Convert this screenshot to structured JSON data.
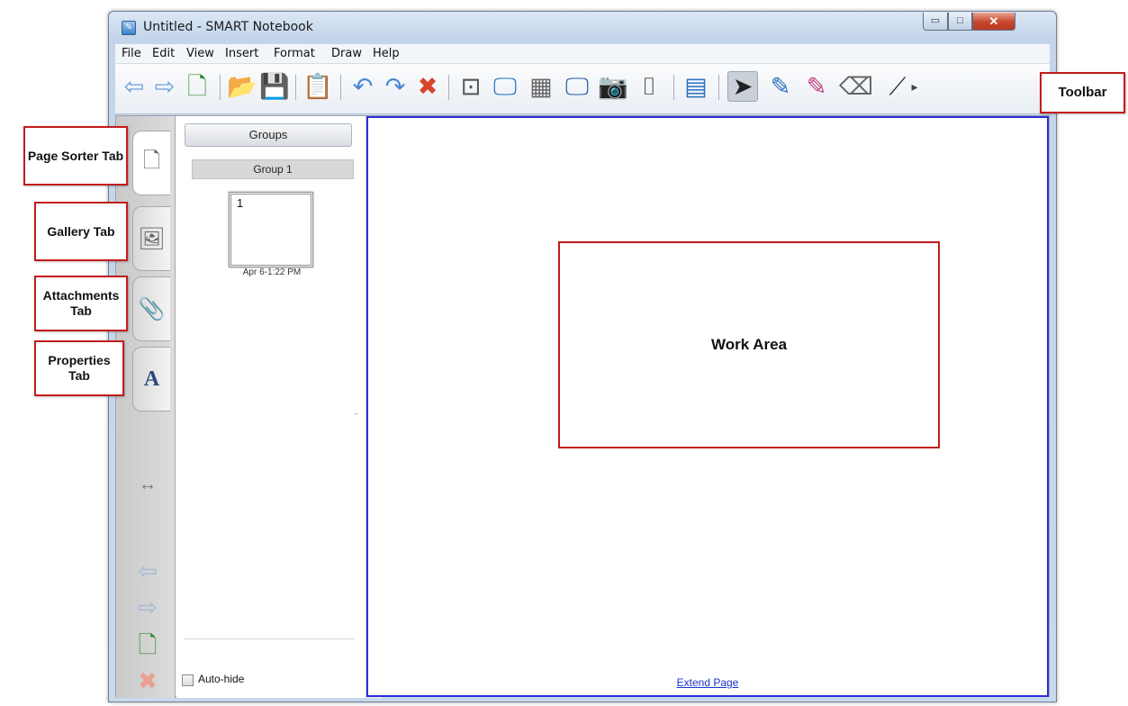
{
  "window": {
    "title": "Untitled - SMART Notebook",
    "minimize_glyph": "▭",
    "maximize_glyph": "□",
    "close_glyph": "✕"
  },
  "menubar": {
    "items": [
      "File",
      "Edit",
      "View",
      "Insert",
      "Format",
      "Draw",
      "Help"
    ]
  },
  "toolbar": {
    "icons": [
      {
        "name": "back-arrow-icon",
        "glyph": "⇦",
        "color": "#6f9fd8"
      },
      {
        "name": "forward-arrow-icon",
        "glyph": "⇨",
        "color": "#6f9fd8"
      },
      {
        "name": "add-page-icon",
        "glyph": "🗋",
        "color": "#2d8b2d"
      },
      {
        "name": "open-file-icon",
        "glyph": "📂",
        "color": "#d9a520"
      },
      {
        "name": "save-icon",
        "glyph": "💾",
        "color": "#2a5fbf"
      },
      {
        "name": "paste-icon",
        "glyph": "📋",
        "color": "#8a6d3b"
      },
      {
        "name": "undo-icon",
        "glyph": "↶",
        "color": "#4a86d4"
      },
      {
        "name": "redo-icon",
        "glyph": "↷",
        "color": "#4a86d4"
      },
      {
        "name": "delete-icon",
        "glyph": "✖",
        "color": "#d9452b"
      },
      {
        "name": "screen-shade-icon",
        "glyph": "⊡",
        "color": "#555555"
      },
      {
        "name": "full-screen-icon",
        "glyph": "🖵",
        "color": "#1f6fc6"
      },
      {
        "name": "transparent-background-icon",
        "glyph": "▦",
        "color": "#666666"
      },
      {
        "name": "dual-page-icon",
        "glyph": "🖵",
        "color": "#2458a6"
      },
      {
        "name": "screen-capture-icon",
        "glyph": "📷",
        "color": "#555555"
      },
      {
        "name": "document-camera-icon",
        "glyph": "⌷",
        "color": "#444444"
      },
      {
        "name": "table-icon",
        "glyph": "▤",
        "color": "#2a6fbf"
      },
      {
        "name": "select-arrow-icon",
        "glyph": "➤",
        "color": "#222222"
      },
      {
        "name": "pen-icon",
        "glyph": "✎",
        "color": "#2a6fbf"
      },
      {
        "name": "creative-pen-icon",
        "glyph": "✎",
        "color": "#c03a7a"
      },
      {
        "name": "eraser-icon",
        "glyph": "⌫",
        "color": "#666666"
      },
      {
        "name": "line-icon",
        "glyph": "⟋",
        "color": "#333333"
      },
      {
        "name": "more-arrow-icon",
        "glyph": "▸",
        "color": "#444444"
      }
    ]
  },
  "side_tabs": [
    {
      "name": "page-sorter-icon",
      "glyph": "🗋"
    },
    {
      "name": "gallery-icon",
      "glyph": "🖼"
    },
    {
      "name": "attachments-icon",
      "glyph": "📎"
    },
    {
      "name": "properties-icon",
      "glyph": "A"
    }
  ],
  "side_nav": {
    "move_icon": "↔",
    "prev_icon": "⇦",
    "next_icon": "⇨",
    "add_icon": "🗋",
    "delete_icon": "✖"
  },
  "side_panel": {
    "groups_label": "Groups",
    "group_header": "Group 1",
    "page_number": "1",
    "page_date": "Apr 6-1:22 PM",
    "autohide_label": "Auto-hide",
    "resize_grip": "⌐"
  },
  "scrollbar": {
    "up": "▲",
    "down": "▼",
    "grip": "≡"
  },
  "work_area": {
    "extend_link": "Extend Page"
  },
  "annotations": {
    "page_sorter": "Page Sorter Tab",
    "gallery": "Gallery Tab",
    "attachments": "Attachments Tab",
    "properties": "Properties Tab",
    "work_area": "Work Area",
    "toolbar": "Toolbar"
  }
}
